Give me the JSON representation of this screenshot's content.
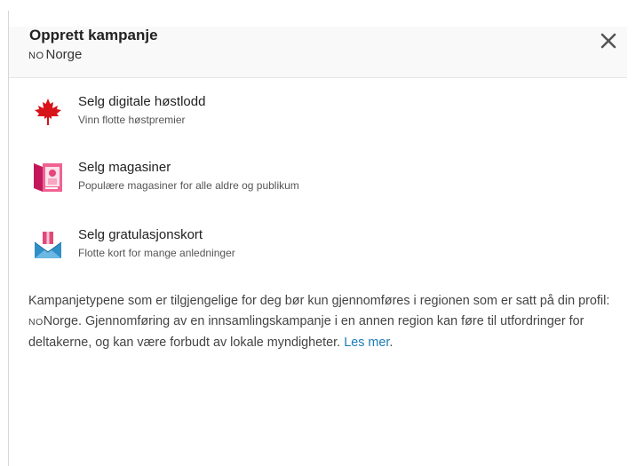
{
  "dialog": {
    "title": "Opprett kampanje",
    "region_code": "NO",
    "region_name": "Norge",
    "close_icon": "close-icon"
  },
  "options": [
    {
      "label": "Selg digitale høstlodd",
      "description": "Vinn flotte høstpremier",
      "icon": "maple-leaf-icon",
      "icon_color": "#d7141a"
    },
    {
      "label": "Selg magasiner",
      "description": "Populære magasiner for alle aldre og publikum",
      "icon": "magazine-icon",
      "icon_color": "#e4477a"
    },
    {
      "label": "Selg gratulasjonskort",
      "description": "Flotte kort for mange anledninger",
      "icon": "greeting-card-icon",
      "icon_color": "#2f8fc6"
    }
  ],
  "info": {
    "text_before": "Kampanjetypene som er tilgjengelige for deg bør kun gjennomføres i regionen som er satt på din profil: ",
    "region_code": "NO",
    "region_name": "Norge",
    "text_after": ". Gjennomføring av en innsamlingskampanje i en annen region kan føre til utfordringer for deltakerne, og kan være forbudt av lokale myndigheter. ",
    "link_label": "Les mer",
    "link_end": "."
  },
  "colors": {
    "link": "#1a7db6",
    "header_bg": "#f9f9f9"
  }
}
